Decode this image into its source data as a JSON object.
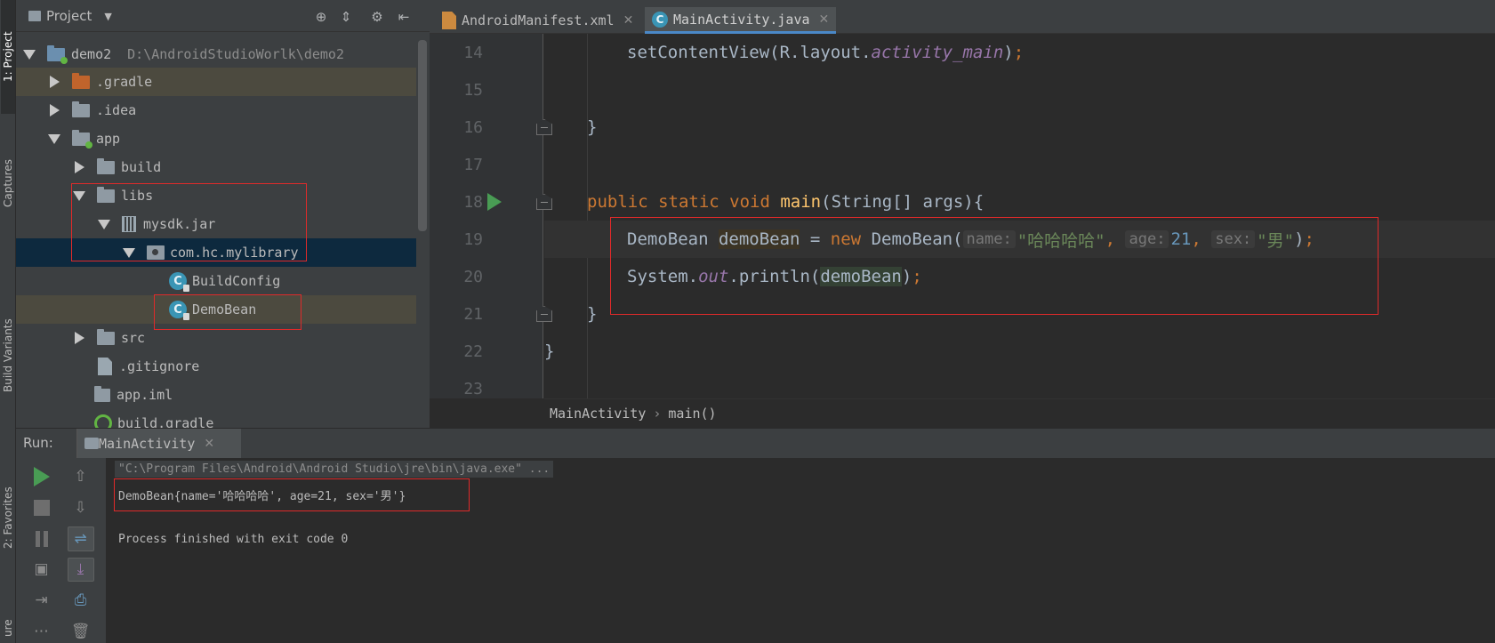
{
  "side_tabs": {
    "project": "1: Project",
    "captures": "Captures",
    "build_variants": "Build Variants",
    "favorites": "2: Favorites",
    "structure": "ure"
  },
  "project_panel": {
    "title": "Project",
    "tree": [
      {
        "label": "demo2",
        "path": "D:\\AndroidStudioWorlk\\demo2"
      },
      {
        "label": ".gradle"
      },
      {
        "label": ".idea"
      },
      {
        "label": "app"
      },
      {
        "label": "build"
      },
      {
        "label": "libs"
      },
      {
        "label": "mysdk.jar"
      },
      {
        "label": "com.hc.mylibrary"
      },
      {
        "label": "BuildConfig"
      },
      {
        "label": "DemoBean"
      },
      {
        "label": "src"
      },
      {
        "label": ".gitignore"
      },
      {
        "label": "app.iml"
      },
      {
        "label": "build.gradle"
      }
    ]
  },
  "editor": {
    "tabs": [
      {
        "label": "AndroidManifest.xml"
      },
      {
        "label": "MainActivity.java"
      }
    ],
    "line_numbers": [
      "14",
      "15",
      "16",
      "17",
      "18",
      "19",
      "20",
      "21",
      "22",
      "23"
    ],
    "code": {
      "l14_a": "setContentView(R.layout.",
      "l14_b": "activity_main",
      "l14_c": ")",
      "l14_d": ";",
      "l16": "}",
      "l18_public": "public ",
      "l18_static": "static ",
      "l18_void": "void ",
      "l18_main": "main",
      "l18_rest": "(String[] args){",
      "l19_a": "DemoBean ",
      "l19_var": "demoBean",
      "l19_b": " = ",
      "l19_new": "new ",
      "l19_c": "DemoBean(",
      "l19_hint_name": "name:",
      "l19_str1": "\"哈哈哈哈\"",
      "l19_comma1": ", ",
      "l19_hint_age": "age:",
      "l19_num": "21",
      "l19_comma2": ", ",
      "l19_hint_sex": "sex:",
      "l19_str2": "\"男\"",
      "l19_close": ")",
      "l19_semi": ";",
      "l20_a": "System.",
      "l20_out": "out",
      "l20_b": ".println(",
      "l20_var": "demoBean",
      "l20_c": ")",
      "l20_semi": ";",
      "l21": "}",
      "l22": "}"
    },
    "breadcrumb": {
      "class": "MainActivity",
      "sep": "›",
      "method": "main()"
    }
  },
  "run_panel": {
    "label": "Run:",
    "tab": "MainActivity",
    "console": {
      "command": "\"C:\\Program Files\\Android\\Android Studio\\jre\\bin\\java.exe\" ...",
      "output": "DemoBean{name='哈哈哈哈', age=21, sex='男'}",
      "exit": "Process finished with exit code 0"
    }
  },
  "colors": {
    "keyword": "#cc7832",
    "function": "#ffc66d",
    "string": "#6a8759",
    "number": "#6897bb",
    "static_field": "#9876aa",
    "annotation_box": "#e02a2a",
    "run_green": "#499c54"
  }
}
